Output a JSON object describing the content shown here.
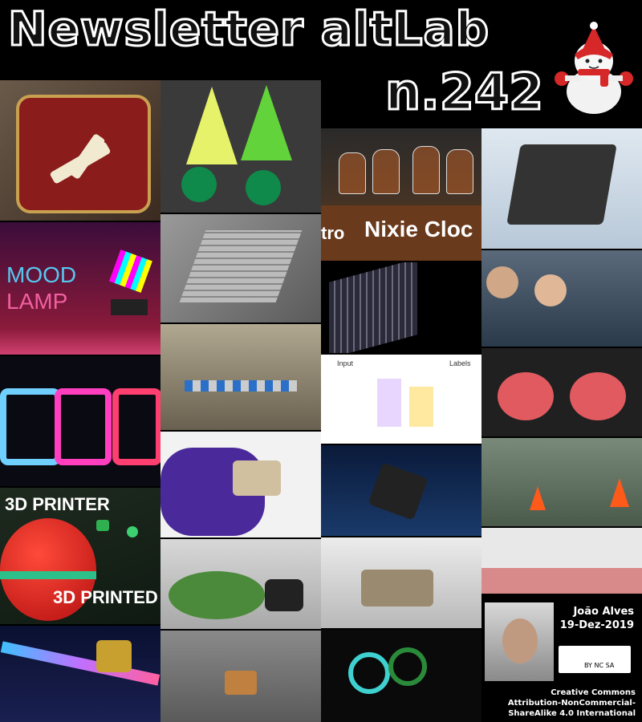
{
  "header": {
    "title": "Newsletter altLab",
    "issue": "n.242"
  },
  "tiles": {
    "mood_lamp_label_1": "MOOD",
    "mood_lamp_label_2": "LAMP",
    "nixie_label": "Nixie Cloc",
    "nixie_partial": "tro",
    "printer_label": "3D PRINTER",
    "printed_label": "3D PRINTED",
    "diagram_input": "Input",
    "diagram_labels": "Labels"
  },
  "credit": {
    "author": "João Alves",
    "date": "19-Dez-2019",
    "license_line1": "Creative Commons",
    "license_line2": "Attribution-NonCommercial-",
    "license_line3": "ShareAlike 4.0 International",
    "cc_badge": "BY NC SA"
  },
  "colors": {
    "background": "#000000",
    "title_stroke": "#ffffff"
  }
}
